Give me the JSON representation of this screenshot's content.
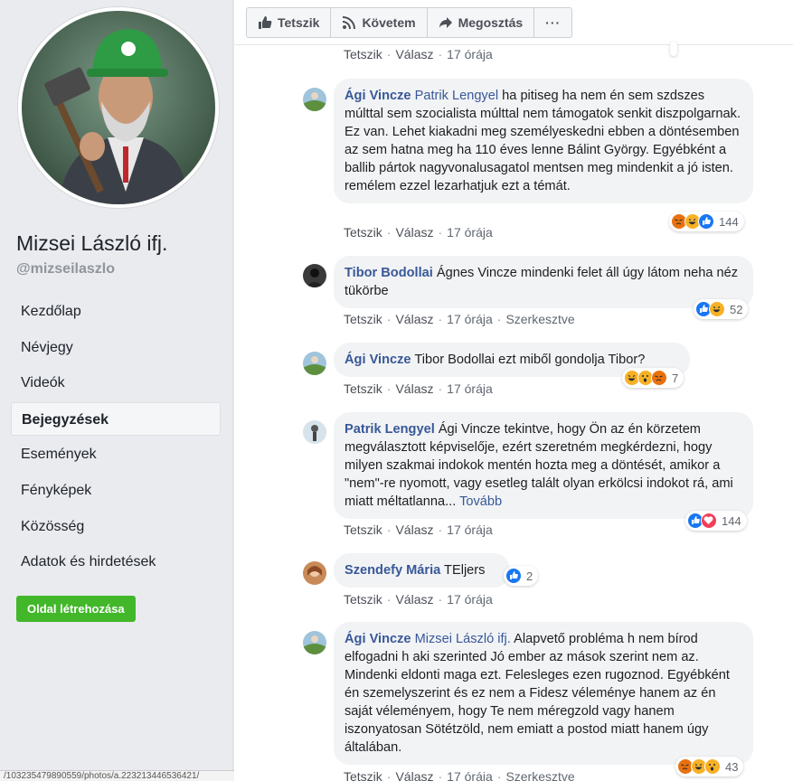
{
  "page": {
    "name": "Mizsei László ifj.",
    "handle": "@mizseilaszlo"
  },
  "nav": {
    "items": [
      {
        "label": "Kezdőlap"
      },
      {
        "label": "Névjegy"
      },
      {
        "label": "Videók"
      },
      {
        "label": "Bejegyzések",
        "active": true
      },
      {
        "label": "Események"
      },
      {
        "label": "Fényképek"
      },
      {
        "label": "Közösség"
      },
      {
        "label": "Adatok és hirdetések"
      }
    ],
    "create_page": "Oldal létrehozása"
  },
  "status_url": "/103235479890559/photos/a.223213446536421/",
  "actions": {
    "like": "Tetszik",
    "follow": "Követem",
    "share": "Megosztás",
    "more": "···"
  },
  "meta": {
    "like": "Tetszik",
    "reply": "Válasz",
    "edited": "Szerkesztve"
  },
  "comments": [
    {
      "author": "Ági Vincze",
      "mention": "Patrik Lengyel",
      "text": "ha pitiseg ha nem én sem szdszes múlttal sem szocialista múlttal nem támogatok senkit diszpolgarnak. Ez van. Lehet kiakadni meg személyeskedni ebben a döntésemben az sem hatna meg ha 110 éves lenne Bálint György. Egyébként a ballib pártok nagyvonalusagatol mentsen meg mindenkit a jó isten. remélem ezzel lezarhatjuk ezt a témát.",
      "time": "17 órája",
      "reactions": [
        "angry",
        "haha",
        "like"
      ],
      "count": "144"
    },
    {
      "author": "Tibor Bodollai",
      "mention": "",
      "text": "Ágnes Vincze mindenki felet áll úgy látom neha néz tükörbe",
      "time": "17 órája",
      "edited": true,
      "reactions": [
        "like",
        "haha"
      ],
      "count": "52"
    },
    {
      "author": "Ági Vincze",
      "mention": "",
      "text": "Tibor Bodollai ezt miből gondolja Tibor?",
      "time": "17 órája",
      "reactions": [
        "haha",
        "wow",
        "angry"
      ],
      "count": "7"
    },
    {
      "author": "Patrik Lengyel",
      "mention": "",
      "text": "Ági Vincze tekintve, hogy Ön az én körzetem megválasztott képviselője, ezért szeretném megkérdezni, hogy milyen szakmai indokok mentén hozta meg a döntését, amikor a \"nem\"-re nyomott, vagy esetleg talált olyan erkölcsi indokot rá, ami miatt méltatlanna...",
      "more": "Tovább",
      "time": "17 órája",
      "reactions": [
        "like",
        "love"
      ],
      "count": "144"
    },
    {
      "author": "Szendefy Mária",
      "mention": "",
      "text": "TEljers",
      "time": "17 órája",
      "reactions": [
        "like"
      ],
      "count": "2"
    },
    {
      "author": "Ági Vincze",
      "mention": "Mizsei László ifj.",
      "text": "Alapvető probléma h nem bírod elfogadni h aki szerinted Jó ember az mások szerint nem az. Mindenki eldonti maga ezt. Felesleges ezen rugoznod. Egyébként én szemelyszerint és ez nem a Fidesz véleménye hanem az én saját véleményem, hogy Te nem méregzold vagy hanem iszonyatosan Sötétzöld, nem emiatt a postod miatt hanem úgy általában.",
      "time": "17 órája",
      "edited": true,
      "reactions": [
        "angry",
        "haha",
        "wow"
      ],
      "count": "43"
    }
  ],
  "top_meta_time": "17 órája",
  "colors": {
    "link": "#385898",
    "bubble": "#f2f3f5",
    "create_btn": "#42b72a",
    "like": "#1877f2"
  }
}
